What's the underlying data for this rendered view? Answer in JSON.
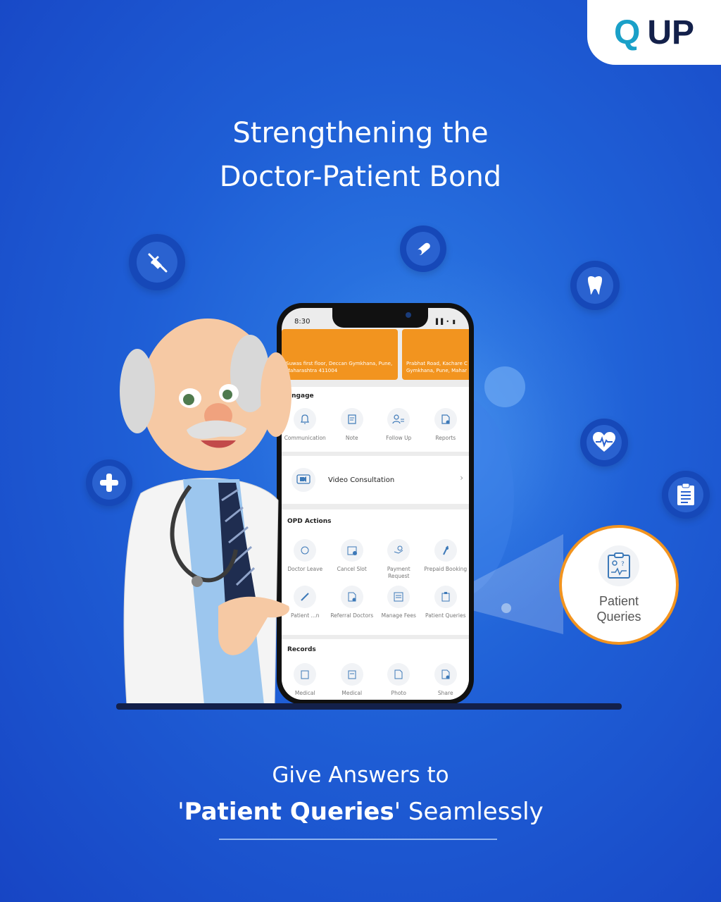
{
  "brand": {
    "logo_q": "Q",
    "logo_up": "UP",
    "accent": "#f2941f",
    "teal": "#1aa0c8",
    "navy": "#13204a"
  },
  "headline": {
    "line1": "Strengthening the",
    "line2": "Doctor-Patient Bond"
  },
  "floating_icons": [
    "syringe-icon",
    "pill-icon",
    "tooth-icon",
    "plus-icon",
    "heart-icon",
    "clipboard-icon"
  ],
  "phone": {
    "time": "8:30",
    "status_icons": "▌▌• ▮",
    "location_cards": [
      {
        "address": "Suwas first floor, Deccan Gymkhana, Pune, Maharashtra 411004"
      },
      {
        "address": "Prabhat Road, Kachare C Gymkhana, Pune, Mahar"
      }
    ],
    "engage": {
      "title": "Engage",
      "items": [
        {
          "label": "Communication",
          "icon": "bell-icon"
        },
        {
          "label": "Note",
          "icon": "note-icon"
        },
        {
          "label": "Follow Up",
          "icon": "follow-up-icon"
        },
        {
          "label": "Reports",
          "icon": "reports-icon"
        }
      ]
    },
    "video": {
      "label": "Video Consultation",
      "chevron": "›"
    },
    "opd": {
      "title": "OPD Actions",
      "items": [
        {
          "label": "Doctor Leave"
        },
        {
          "label": "Cancel Slot"
        },
        {
          "label": "Payment Request"
        },
        {
          "label": "Prepaid Booking"
        },
        {
          "label": "Patient ...n"
        },
        {
          "label": "Referral Doctors"
        },
        {
          "label": "Manage Fees"
        },
        {
          "label": "Patient Queries"
        }
      ]
    },
    "records": {
      "title": "Records",
      "items": [
        {
          "label": "Medical"
        },
        {
          "label": "Medical"
        },
        {
          "label": "Photo"
        },
        {
          "label": "Share"
        }
      ]
    }
  },
  "callout": {
    "line1": "Patient",
    "line2": "Queries"
  },
  "bottom": {
    "line1": "Give Answers to",
    "quote_open": "'",
    "highlight": "Patient Queries",
    "quote_close": "'",
    "rest": " Seamlessly"
  }
}
